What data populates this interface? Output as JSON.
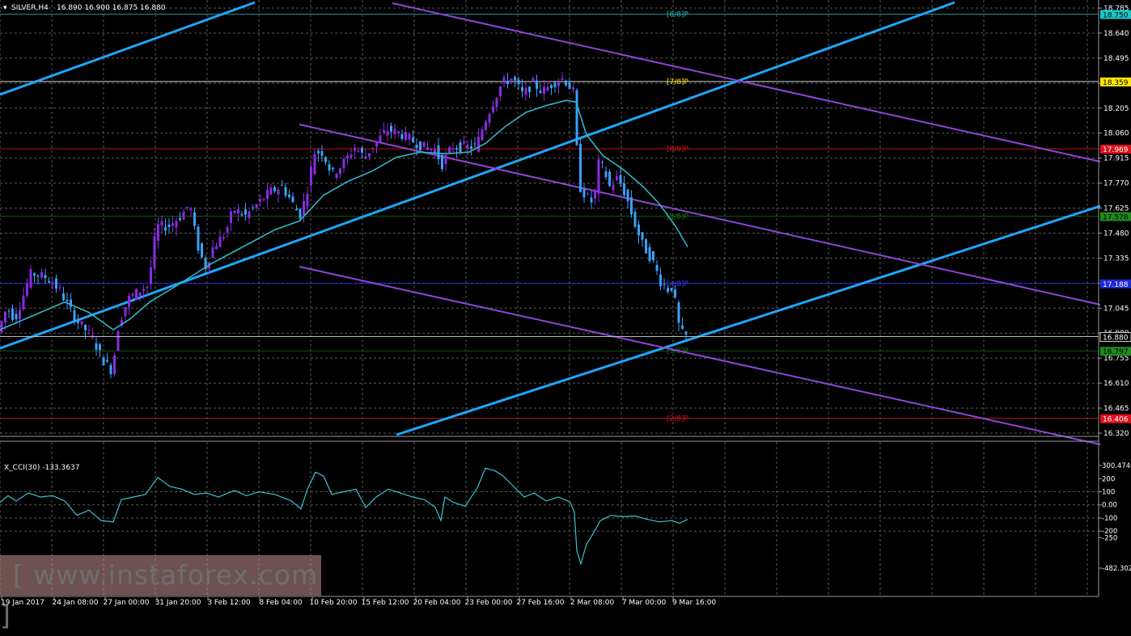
{
  "window": {
    "symbol_label": "SILVER,H4",
    "ohlc_text": "16.890 16.900 16.875 16.880"
  },
  "indicator": {
    "label": "X_CCI(30) -133.3637"
  },
  "watermark": "[ www.instaforex.com ]",
  "colors": {
    "grid": "#5a5a5a",
    "bull": "#8a2be2",
    "bear": "#3aa0ff",
    "ma": "#2fb7c4",
    "trend": "#1ea7ff",
    "channel": "#8f45d8",
    "cci": "#36c4d1",
    "murrey_red": "#c0101c",
    "murrey_blue": "#1e2ad8",
    "murrey_green": "#0a5a10",
    "price_line": "#bdbdbd"
  },
  "chart_data": {
    "type": "candlestick",
    "title": "SILVER,H4",
    "y_axis": {
      "min": 16.32,
      "max": 18.785,
      "ticks": [
        "18.785",
        "18.640",
        "18.495",
        "18.350",
        "18.205",
        "18.060",
        "17.915",
        "17.770",
        "17.625",
        "17.480",
        "17.335",
        "17.190",
        "17.045",
        "16.900",
        "16.755",
        "16.610",
        "16.465",
        "16.320"
      ]
    },
    "x_axis": {
      "tick_labels": [
        "19 Jan 2017",
        "24 Jan 08:00",
        "27 Jan 00:00",
        "31 Jan 20:00",
        "3 Feb 12:00",
        "8 Feb 04:00",
        "10 Feb 20:00",
        "15 Feb 12:00",
        "20 Feb 04:00",
        "23 Feb 00:00",
        "27 Feb 16:00",
        "2 Mar 08:00",
        "7 Mar 00:00",
        "9 Mar 16:00"
      ]
    },
    "price_path": [
      [
        0,
        16.92
      ],
      [
        10,
        17.05
      ],
      [
        20,
        16.98
      ],
      [
        40,
        17.25
      ],
      [
        60,
        17.22
      ],
      [
        75,
        17.15
      ],
      [
        95,
        16.98
      ],
      [
        115,
        16.88
      ],
      [
        128,
        16.75
      ],
      [
        140,
        16.68
      ],
      [
        148,
        16.95
      ],
      [
        160,
        17.1
      ],
      [
        175,
        17.15
      ],
      [
        185,
        17.18
      ],
      [
        195,
        17.52
      ],
      [
        210,
        17.52
      ],
      [
        225,
        17.58
      ],
      [
        236,
        17.65
      ],
      [
        245,
        17.42
      ],
      [
        255,
        17.28
      ],
      [
        265,
        17.4
      ],
      [
        280,
        17.48
      ],
      [
        290,
        17.62
      ],
      [
        305,
        17.58
      ],
      [
        320,
        17.65
      ],
      [
        335,
        17.72
      ],
      [
        350,
        17.75
      ],
      [
        360,
        17.68
      ],
      [
        372,
        17.58
      ],
      [
        380,
        17.7
      ],
      [
        390,
        17.95
      ],
      [
        400,
        17.95
      ],
      [
        412,
        17.82
      ],
      [
        425,
        17.88
      ],
      [
        440,
        17.98
      ],
      [
        452,
        17.92
      ],
      [
        465,
        18.0
      ],
      [
        480,
        18.08
      ],
      [
        495,
        18.06
      ],
      [
        510,
        18.02
      ],
      [
        525,
        17.98
      ],
      [
        538,
        17.97
      ],
      [
        548,
        17.88
      ],
      [
        560,
        17.98
      ],
      [
        575,
        17.98
      ],
      [
        590,
        17.98
      ],
      [
        600,
        18.12
      ],
      [
        612,
        18.25
      ],
      [
        622,
        18.35
      ],
      [
        635,
        18.38
      ],
      [
        648,
        18.28
      ],
      [
        660,
        18.35
      ],
      [
        672,
        18.3
      ],
      [
        685,
        18.35
      ],
      [
        698,
        18.38
      ],
      [
        710,
        18.3
      ],
      [
        714,
        18.0
      ],
      [
        718,
        17.75
      ],
      [
        725,
        17.7
      ],
      [
        735,
        17.65
      ],
      [
        742,
        17.9
      ],
      [
        748,
        17.85
      ],
      [
        755,
        17.75
      ],
      [
        765,
        17.8
      ],
      [
        775,
        17.7
      ],
      [
        785,
        17.55
      ],
      [
        795,
        17.42
      ],
      [
        808,
        17.32
      ],
      [
        818,
        17.2
      ],
      [
        828,
        17.15
      ],
      [
        834,
        17.18
      ],
      [
        838,
        16.98
      ],
      [
        844,
        16.9
      ],
      [
        850,
        16.88
      ]
    ],
    "moving_average": [
      [
        0,
        16.92
      ],
      [
        40,
        17.0
      ],
      [
        80,
        17.08
      ],
      [
        110,
        17.02
      ],
      [
        140,
        16.92
      ],
      [
        160,
        16.98
      ],
      [
        185,
        17.08
      ],
      [
        220,
        17.18
      ],
      [
        260,
        17.3
      ],
      [
        300,
        17.4
      ],
      [
        340,
        17.5
      ],
      [
        370,
        17.55
      ],
      [
        400,
        17.7
      ],
      [
        430,
        17.78
      ],
      [
        460,
        17.84
      ],
      [
        490,
        17.92
      ],
      [
        520,
        17.95
      ],
      [
        550,
        17.94
      ],
      [
        580,
        17.95
      ],
      [
        600,
        18.0
      ],
      [
        625,
        18.1
      ],
      [
        650,
        18.18
      ],
      [
        675,
        18.22
      ],
      [
        700,
        18.25
      ],
      [
        712,
        18.24
      ],
      [
        725,
        18.05
      ],
      [
        745,
        17.93
      ],
      [
        770,
        17.85
      ],
      [
        795,
        17.75
      ],
      [
        815,
        17.65
      ],
      [
        835,
        17.52
      ],
      [
        850,
        17.4
      ]
    ],
    "murrey_levels": [
      {
        "label": "[8/8]P",
        "price": 18.75,
        "price_text": "18.750",
        "color": "cyan"
      },
      {
        "label": "[7/8]P",
        "price": 18.359,
        "price_text": "18.359",
        "color": "yellow"
      },
      {
        "label": "[6/8]P",
        "price": 17.969,
        "price_text": "17.969",
        "color": "red"
      },
      {
        "label": "[5/8]P",
        "price": 17.578,
        "price_text": "17.578",
        "color": "green"
      },
      {
        "label": "[4/8]P",
        "price": 17.188,
        "price_text": "17.188",
        "color": "blue"
      },
      {
        "label": "[3/8]P",
        "price": 16.797,
        "price_text": "16.797",
        "color": "green"
      },
      {
        "label": "[2/8]P",
        "price": 16.406,
        "price_text": "16.406",
        "color": "red"
      }
    ],
    "current_price": {
      "price": 16.88,
      "price_text": "16.880"
    },
    "cci": {
      "name": "X_CCI(30)",
      "value": -133.3637,
      "y_ticks": [
        "300.4746",
        "200",
        "100",
        "0.00",
        "-100",
        "-200",
        "-250",
        "-482.3021"
      ],
      "path": [
        [
          0,
          20
        ],
        [
          10,
          70
        ],
        [
          20,
          30
        ],
        [
          35,
          90
        ],
        [
          50,
          60
        ],
        [
          65,
          70
        ],
        [
          80,
          30
        ],
        [
          95,
          -80
        ],
        [
          110,
          -40
        ],
        [
          125,
          -120
        ],
        [
          140,
          -130
        ],
        [
          150,
          40
        ],
        [
          165,
          60
        ],
        [
          180,
          80
        ],
        [
          195,
          210
        ],
        [
          210,
          140
        ],
        [
          225,
          120
        ],
        [
          240,
          80
        ],
        [
          255,
          90
        ],
        [
          270,
          60
        ],
        [
          290,
          110
        ],
        [
          305,
          70
        ],
        [
          320,
          100
        ],
        [
          340,
          80
        ],
        [
          360,
          30
        ],
        [
          372,
          -30
        ],
        [
          380,
          120
        ],
        [
          390,
          250
        ],
        [
          400,
          220
        ],
        [
          410,
          80
        ],
        [
          425,
          100
        ],
        [
          440,
          120
        ],
        [
          452,
          -20
        ],
        [
          465,
          60
        ],
        [
          480,
          120
        ],
        [
          495,
          90
        ],
        [
          510,
          60
        ],
        [
          525,
          40
        ],
        [
          538,
          -20
        ],
        [
          545,
          -120
        ],
        [
          550,
          60
        ],
        [
          560,
          20
        ],
        [
          575,
          -10
        ],
        [
          590,
          130
        ],
        [
          600,
          280
        ],
        [
          612,
          260
        ],
        [
          622,
          220
        ],
        [
          635,
          140
        ],
        [
          648,
          60
        ],
        [
          660,
          90
        ],
        [
          675,
          30
        ],
        [
          690,
          60
        ],
        [
          705,
          20
        ],
        [
          710,
          -60
        ],
        [
          713,
          -350
        ],
        [
          718,
          -450
        ],
        [
          725,
          -300
        ],
        [
          735,
          -200
        ],
        [
          742,
          -120
        ],
        [
          755,
          -80
        ],
        [
          770,
          -90
        ],
        [
          785,
          -85
        ],
        [
          800,
          -110
        ],
        [
          815,
          -130
        ],
        [
          830,
          -120
        ],
        [
          840,
          -140
        ],
        [
          850,
          -110
        ]
      ]
    },
    "trend_lines": [
      "ascending support/resistance (light blue)",
      "descending regression channel (purple)"
    ]
  }
}
